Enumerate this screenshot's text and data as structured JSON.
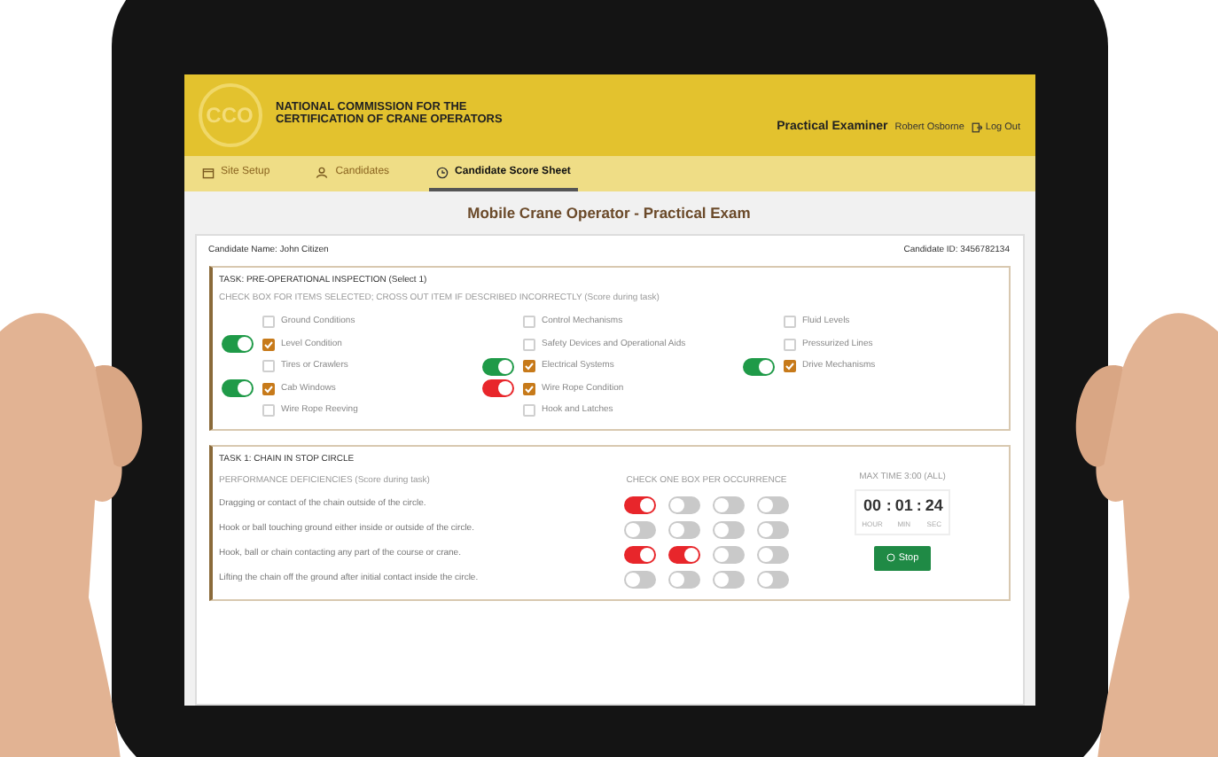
{
  "header": {
    "logo": "CCO",
    "org_line_1": "NATIONAL COMMISSION FOR THE",
    "org_line_2": "CERTIFICATION OF CRANE OPERATORS",
    "role": "Practical Examiner",
    "user": "Robert Osborne",
    "logout": "Log Out"
  },
  "tabs": [
    {
      "label": "Site Setup",
      "kind": "calendar",
      "selected": false
    },
    {
      "label": "Candidates",
      "kind": "user",
      "selected": false
    },
    {
      "label": "Candidate Score Sheet",
      "kind": "clock",
      "selected": true
    }
  ],
  "title": "Mobile Crane Operator - Practical Exam",
  "candidate_name": "Candidate Name: John Citizen",
  "candidate_id": "Candidate ID: 3456782134",
  "inspection": {
    "title": "TASK: PRE-OPERATIONAL INSPECTION (Select 1)",
    "instruction": "CHECK BOX FOR ITEMS SELECTED; CROSS OUT ITEM IF DESCRIBED INCORRECTLY (Score during task)",
    "columns": [
      [
        {
          "label": "Ground Conditions",
          "checked": false
        },
        {
          "label": "Level Condition",
          "checked": true,
          "toggle": {
            "on": true,
            "color": "#1f9a48"
          }
        },
        {
          "label": "Tires or Crawlers",
          "checked": false
        },
        {
          "label": "Cab Windows",
          "checked": true,
          "toggle": {
            "on": true,
            "color": "#1f9a48"
          }
        },
        {
          "label": "Wire Rope Reeving",
          "checked": false
        }
      ],
      [
        {
          "label": "Control Mechanisms",
          "checked": false
        },
        {
          "label": "Safety Devices and Operational Aids",
          "checked": false
        },
        {
          "label": "Electrical Systems",
          "checked": true,
          "toggle": {
            "on": true,
            "color": "#1f9a48"
          }
        },
        {
          "label": "Wire Rope Condition",
          "checked": true,
          "toggle": {
            "on": true,
            "color": "#e8262b"
          }
        },
        {
          "label": "Hook and Latches",
          "checked": false
        }
      ],
      [
        {
          "label": "Fluid Levels",
          "checked": false
        },
        {
          "label": "Pressurized Lines",
          "checked": false
        },
        {
          "label": "Drive Mechanisms",
          "checked": true,
          "toggle": {
            "on": true,
            "color": "#1f9a48"
          }
        }
      ]
    ]
  },
  "task": {
    "title": "TASK 1: CHAIN IN STOP CIRCLE",
    "subtitle": "PERFORMANCE DEFICIENCIES (Score during task)",
    "checks_heading": "CHECK ONE BOX PER OCCURRENCE",
    "max_time": "MAX TIME 3:00 (ALL)",
    "rows": [
      {
        "label": "Dragging or contact of the chain outside of the circle.",
        "occurrences": [
          {
            "on": true
          },
          {
            "on": false
          },
          {
            "on": false
          },
          {
            "on": false
          }
        ]
      },
      {
        "label": "Hook or ball touching ground either inside or outside of the circle.",
        "occurrences": [
          {
            "on": false
          },
          {
            "on": false
          },
          {
            "on": false
          },
          {
            "on": false
          }
        ]
      },
      {
        "label": "Hook, ball or chain contacting any part of the course or crane.",
        "occurrences": [
          {
            "on": true
          },
          {
            "on": true
          },
          {
            "on": false
          },
          {
            "on": false
          }
        ]
      },
      {
        "label": "Lifting the chain off the ground after initial contact inside the circle.",
        "occurrences": [
          {
            "on": false
          },
          {
            "on": false
          },
          {
            "on": false
          },
          {
            "on": false
          }
        ]
      }
    ],
    "timer": [
      {
        "value": "00",
        "unit": "HOUR"
      },
      {
        "value": "01",
        "unit": "MIN"
      },
      {
        "value": "24",
        "unit": "SEC"
      }
    ],
    "separator": ":",
    "button": "Stop"
  }
}
